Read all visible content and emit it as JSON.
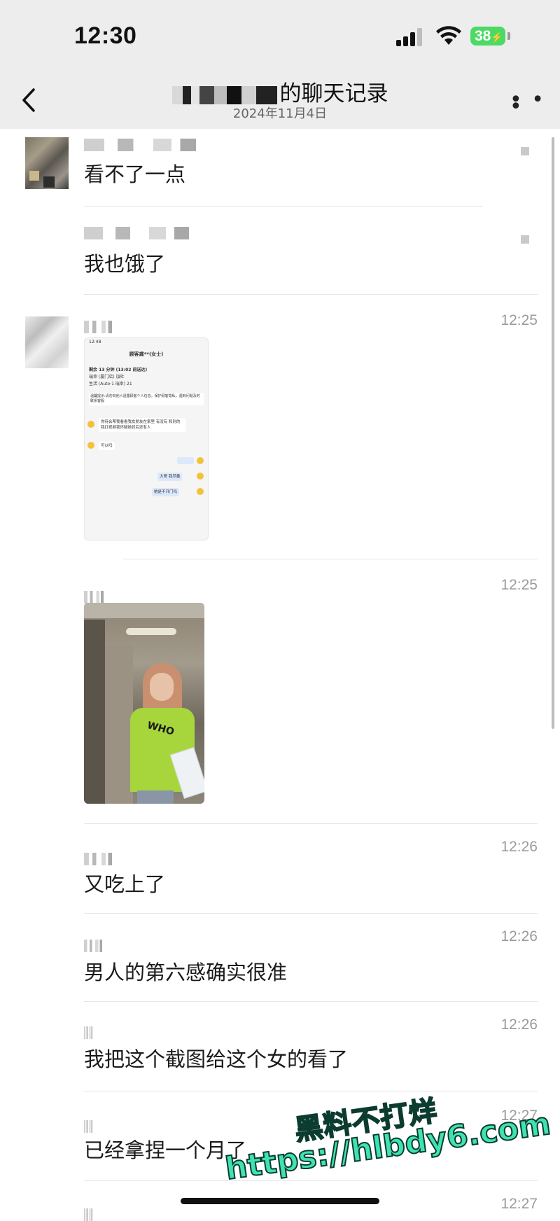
{
  "status_bar": {
    "time": "12:30",
    "battery": "38"
  },
  "nav": {
    "title_suffix": "的聊天记录",
    "date": "2024年11月4日"
  },
  "messages": [
    {
      "time": "",
      "text": "看不了一点"
    },
    {
      "time": "",
      "text": "我也饿了"
    },
    {
      "time": "12:25",
      "type": "screenshot"
    },
    {
      "time": "12:25",
      "type": "photo"
    },
    {
      "time": "12:26",
      "text": "又吃上了"
    },
    {
      "time": "12:26",
      "text": "男人的第六感确实很准"
    },
    {
      "time": "12:26",
      "text": "我把这个截图给这个女的看了"
    },
    {
      "time": "12:27",
      "text": "已经拿捏一个月了"
    },
    {
      "time": "12:27",
      "text": ""
    }
  ],
  "screenshot": {
    "status_time": "12:48",
    "title": "顾客龚**(女士)",
    "line1": "剩余 13 分钟 (13:02 前送达)",
    "line2": "瑞幸 (厦门店) 加杜",
    "line3": "生活 (Auto·1 瑞幸) 21",
    "notice": "温馨提示:请勿向他人透露顾客个人信息。保护顾客隐私，遇到问题及时联系客服",
    "bubble1": "你待会帮我看看我女朋友在家里 有没有 和别的我打视频我怀疑她背后还有人",
    "bubble2": "可以吗",
    "reply1": "大哥 我尽量",
    "reply2": "她是不开门吗"
  },
  "photo_shirt": "WHO",
  "watermark": {
    "line1": "黑料不打烊",
    "line2": "https://hlbdy6.com"
  },
  "colors": {
    "background": "#ededed",
    "battery": "#4cd964",
    "watermark": "#3fe3b2"
  }
}
